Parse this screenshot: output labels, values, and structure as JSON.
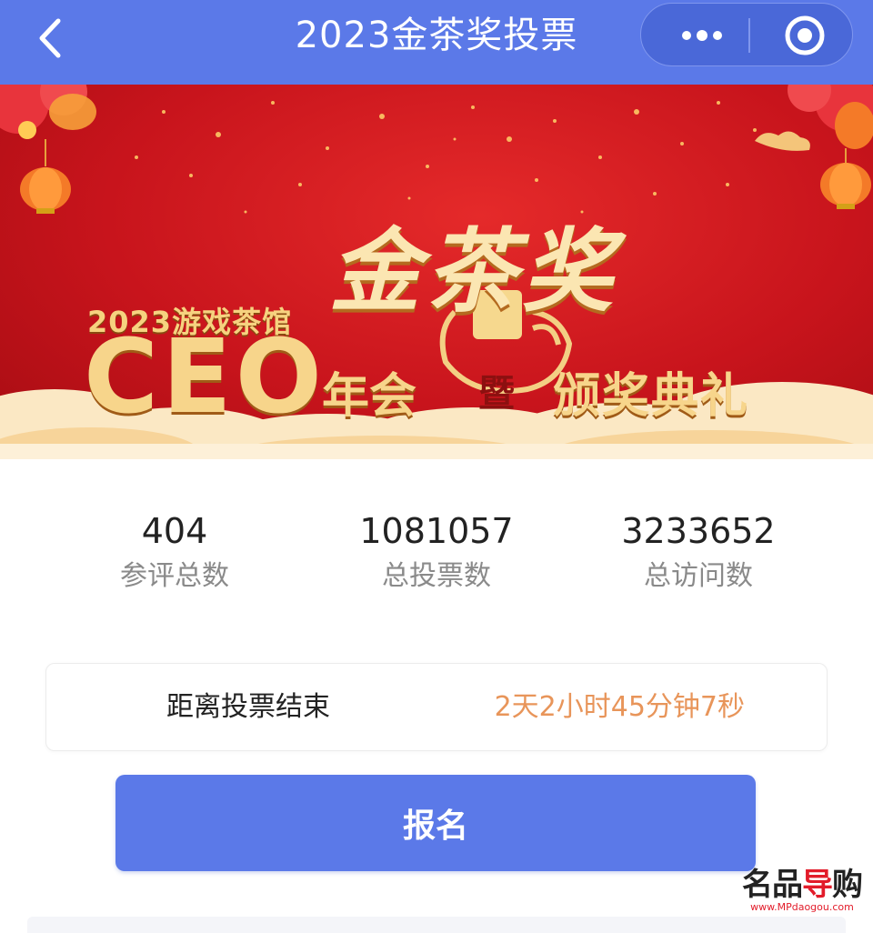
{
  "header": {
    "title": "2023金茶奖投票",
    "back_icon": "chevron-left-icon",
    "more_icon": "more-dots-icon",
    "close_icon": "target-close-icon",
    "background": "#5b79e8"
  },
  "banner": {
    "subtitle": "2023游戏茶馆",
    "ceo": "CEO",
    "award_name": "金茶奖",
    "annual_meeting": "年会",
    "connector": "暨",
    "ceremony": "颁奖典礼",
    "colors": {
      "red": "#c8141c",
      "gold": "#f7d58b"
    }
  },
  "stats": [
    {
      "value": "404",
      "label": "参评总数"
    },
    {
      "value": "1081057",
      "label": "总投票数"
    },
    {
      "value": "3233652",
      "label": "总访问数"
    }
  ],
  "countdown": {
    "label": "距离投票结束",
    "value": "2天2小时45分钟7秒",
    "value_color": "#e8955a"
  },
  "signup_button": {
    "label": "报名"
  },
  "watermark": {
    "logo_black": "名品",
    "logo_red": "导",
    "logo_black2": "购",
    "url": "www.MPdaogou.com"
  }
}
